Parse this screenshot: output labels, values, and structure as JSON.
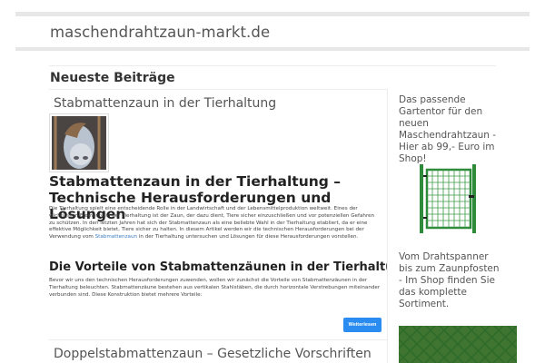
{
  "site": {
    "title": "maschendrahtzaun-markt.de"
  },
  "section": {
    "title": "Neueste Beiträge"
  },
  "post": {
    "title": "Stabmattenzaun in der Tierhaltung",
    "article_heading": "Stabmattenzaun in der Tierhaltung – Technische Herausforderungen und Lösungen",
    "intro_before_link": "Die Tierhaltung spielt eine entscheidende Rolle in der Landwirtschaft und der Lebensmittelproduktion weltweit. Eines der wichtigsten Elemente in der Tierhaltung ist der Zaun, der dazu dient, Tiere sicher einzuschließen und vor potenziellen Gefahren zu schützen. In den letzten Jahren hat sich der Stabmattenzaun als eine beliebte Wahl in der Tierhaltung etabliert, da er eine effektive Möglichkeit bietet, Tiere sicher zu halten. In diesem Artikel werden wir die technischen Herausforderungen bei der Verwendung vom ",
    "intro_link": "Stabmattenzaun",
    "intro_after_link": " in der Tierhaltung untersuchen und Lösungen für diese Herausforderungen vorstellen.",
    "subheading": "Die Vorteile von Stabmattenzäunen in der Tierhaltung",
    "body": "Bevor wir uns den technischen Herausforderungen zuwenden, wollen wir zunächst die Vorteile von Stabmattenzäunen in der Tierhaltung beleuchten. Stabmattenzäune bestehen aus vertikalen Stahlstäben, die durch horizontale Verstrebungen miteinander verbunden sind. Diese Konstruktion bietet mehrere Vorteile:",
    "read_more_label": "Weiterlesen"
  },
  "post2": {
    "title": "Doppelstabmattenzaun – Gesetzliche Vorschriften"
  },
  "sidebar": {
    "ad1_text": "Das passende Gartentor für den neuen Maschendrahtzaun - Hier ab 99,- Euro im Shop!",
    "ad2_text": "Vom Drahtspanner bis zum Zaunpfosten - Im Shop finden Sie das komplette Sortiment."
  },
  "colors": {
    "accent": "#2a8cf0",
    "link": "#3a7bbf",
    "gate_green": "#2e8b3a"
  }
}
